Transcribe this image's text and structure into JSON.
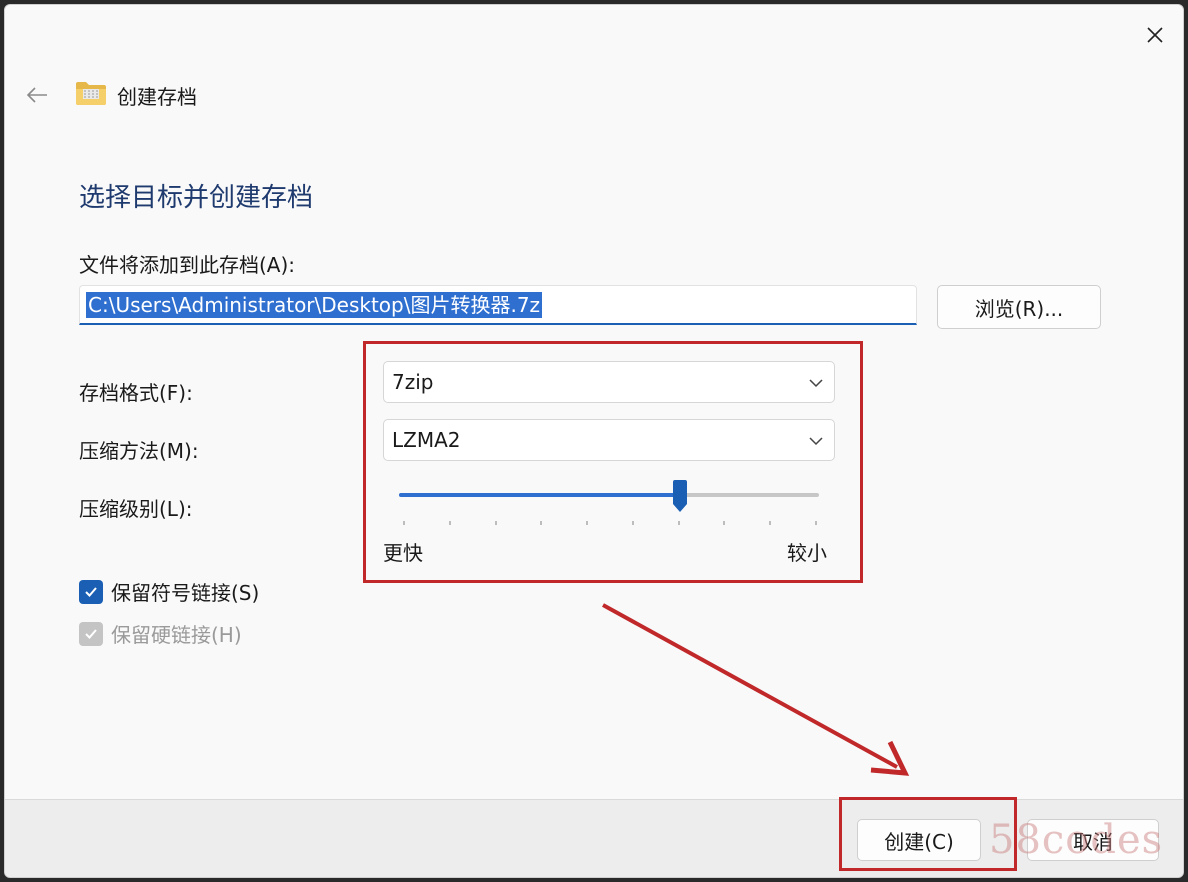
{
  "window": {
    "title": "创建存档",
    "heading": "选择目标并创建存档"
  },
  "archive_path": {
    "label": "文件将添加到此存档(A):",
    "value": "C:\\Users\\Administrator\\Desktop\\图片转换器.7z",
    "browse_label": "浏览(R)..."
  },
  "settings": {
    "format_label": "存档格式(F):",
    "format_value": "7zip",
    "method_label": "压缩方法(M):",
    "method_value": "LZMA2",
    "level_label": "压缩级别(L):",
    "level_fraction": 0.67,
    "level_min_label": "更快",
    "level_max_label": "较小"
  },
  "options": {
    "keep_symlinks_label": "保留符号链接(S)",
    "keep_symlinks_checked": true,
    "keep_hardlinks_label": "保留硬链接(H)",
    "keep_hardlinks_checked": true,
    "keep_hardlinks_enabled": false
  },
  "footer": {
    "create_label": "创建(C)",
    "cancel_label": "取消"
  },
  "watermark": "58codes",
  "colors": {
    "accent": "#1a5fb4",
    "heading": "#1e3a6e",
    "annotation_red": "#c0282a"
  },
  "icons": {
    "close": "close-icon",
    "back": "back-arrow-icon",
    "folder": "zip-folder-icon",
    "chevron": "chevron-down-icon",
    "check": "checkmark-icon"
  }
}
